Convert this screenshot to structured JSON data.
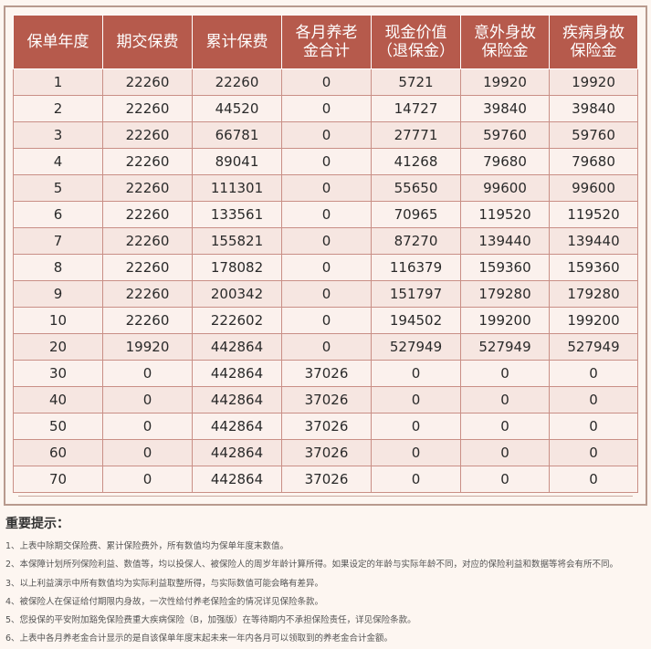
{
  "table": {
    "headers": [
      [
        "保单年度"
      ],
      [
        "期交保费"
      ],
      [
        "累计保费"
      ],
      [
        "各月养老",
        "金合计"
      ],
      [
        "现金价值",
        "（退保金）"
      ],
      [
        "意外身故",
        "保险金"
      ],
      [
        "疾病身故",
        "保险金"
      ]
    ],
    "rows": [
      [
        "1",
        "22260",
        "22260",
        "0",
        "5721",
        "19920",
        "19920"
      ],
      [
        "2",
        "22260",
        "44520",
        "0",
        "14727",
        "39840",
        "39840"
      ],
      [
        "3",
        "22260",
        "66781",
        "0",
        "27771",
        "59760",
        "59760"
      ],
      [
        "4",
        "22260",
        "89041",
        "0",
        "41268",
        "79680",
        "79680"
      ],
      [
        "5",
        "22260",
        "111301",
        "0",
        "55650",
        "99600",
        "99600"
      ],
      [
        "6",
        "22260",
        "133561",
        "0",
        "70965",
        "119520",
        "119520"
      ],
      [
        "7",
        "22260",
        "155821",
        "0",
        "87270",
        "139440",
        "139440"
      ],
      [
        "8",
        "22260",
        "178082",
        "0",
        "116379",
        "159360",
        "159360"
      ],
      [
        "9",
        "22260",
        "200342",
        "0",
        "151797",
        "179280",
        "179280"
      ],
      [
        "10",
        "22260",
        "222602",
        "0",
        "194502",
        "199200",
        "199200"
      ],
      [
        "20",
        "19920",
        "442864",
        "0",
        "527949",
        "527949",
        "527949"
      ],
      [
        "30",
        "0",
        "442864",
        "37026",
        "0",
        "0",
        "0"
      ],
      [
        "40",
        "0",
        "442864",
        "37026",
        "0",
        "0",
        "0"
      ],
      [
        "50",
        "0",
        "442864",
        "37026",
        "0",
        "0",
        "0"
      ],
      [
        "60",
        "0",
        "442864",
        "37026",
        "0",
        "0",
        "0"
      ],
      [
        "70",
        "0",
        "442864",
        "37026",
        "0",
        "0",
        "0"
      ]
    ]
  },
  "notes": {
    "title": "重要提示：",
    "items": [
      "1、上表中除期交保险费、累计保险费外，所有数值均为保单年度末数值。",
      "2、本保障计划所列保险利益、数值等，均以投保人、被保险人的周岁年龄计算所得。如果设定的年龄与实际年龄不同，对应的保险利益和数据等将会有所不同。",
      "3、以上利益演示中所有数值均为实际利益取整所得，与实际数值可能会略有差异。",
      "4、被保险人在保证给付期限内身故，一次性给付养老保险金的情况详见保险条款。",
      "5、您投保的平安附加豁免保险费重大疾病保险（B，加强版）在等待期内不承担保险责任，详见保险条款。",
      "6、上表中各月养老金合计显示的是自该保单年度末起未来一年内各月可以领取到的养老金合计金额。"
    ]
  },
  "colors": {
    "header_bg": "#b65a4c",
    "row_odd": "#f6e6e1",
    "row_even": "#fbf1ed",
    "frame": "#b89a8e"
  }
}
